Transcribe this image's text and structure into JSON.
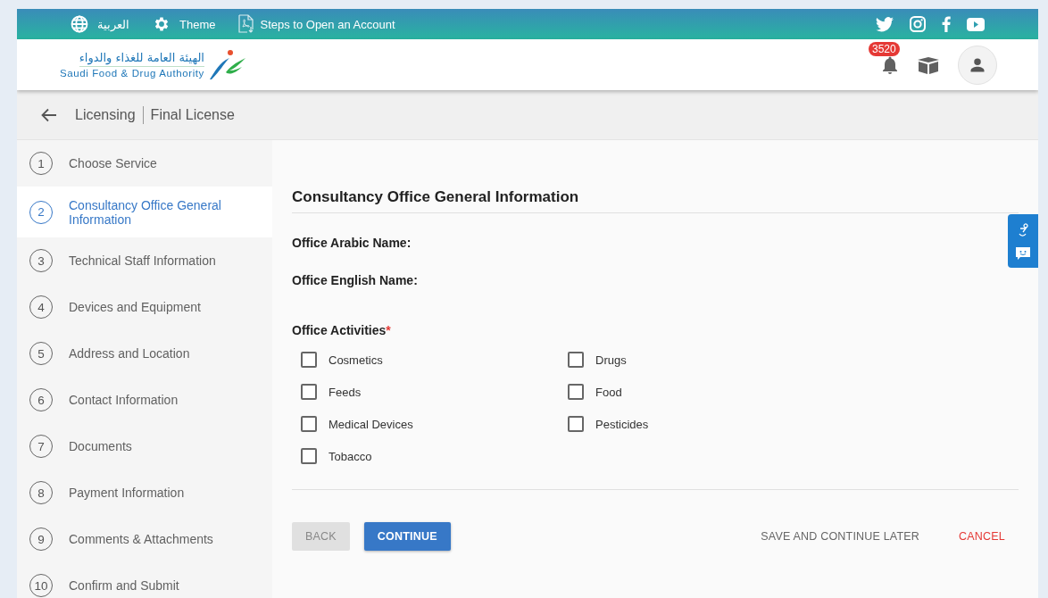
{
  "top_bar": {
    "language": "العربية",
    "theme": "Theme",
    "guide": "Steps to Open an Account"
  },
  "header": {
    "logo_arabic": "الهيئة العامة للغذاء والدواء",
    "logo_english": "Saudi Food & Drug Authority",
    "notification_count": "3520"
  },
  "breadcrumb": {
    "section": "Licensing",
    "page": "Final License"
  },
  "steps": [
    {
      "number": "1",
      "label": "Choose Service",
      "selected": false
    },
    {
      "number": "2",
      "label": "Consultancy Office General Information",
      "selected": true
    },
    {
      "number": "3",
      "label": "Technical Staff Information",
      "selected": false
    },
    {
      "number": "4",
      "label": "Devices and Equipment",
      "selected": false
    },
    {
      "number": "5",
      "label": "Address and Location",
      "selected": false
    },
    {
      "number": "6",
      "label": "Contact Information",
      "selected": false
    },
    {
      "number": "7",
      "label": "Documents",
      "selected": false
    },
    {
      "number": "8",
      "label": "Payment Information",
      "selected": false
    },
    {
      "number": "9",
      "label": "Comments & Attachments",
      "selected": false
    },
    {
      "number": "10",
      "label": "Confirm and Submit",
      "selected": false
    }
  ],
  "form": {
    "title": "Consultancy Office General Information",
    "fields": [
      {
        "label": "Office Arabic Name:"
      },
      {
        "label": "Office English Name:"
      }
    ],
    "activities_label": "Office Activities",
    "required_mark": "*",
    "activities": [
      {
        "label": "Cosmetics",
        "checked": false
      },
      {
        "label": "Drugs",
        "checked": false
      },
      {
        "label": "Feeds",
        "checked": false
      },
      {
        "label": "Food",
        "checked": false
      },
      {
        "label": "Medical Devices",
        "checked": false
      },
      {
        "label": "Pesticides",
        "checked": false
      },
      {
        "label": "Tobacco",
        "checked": false
      }
    ]
  },
  "buttons": {
    "back": "BACK",
    "continue": "CONTINUE",
    "save_later": "SAVE AND CONTINUE LATER",
    "cancel": "CANCEL"
  }
}
